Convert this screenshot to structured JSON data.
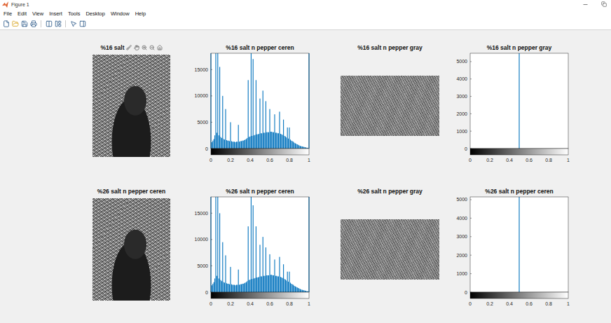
{
  "window": {
    "title": "Figure 1"
  },
  "menu": [
    "File",
    "Edit",
    "View",
    "Insert",
    "Tools",
    "Desktop",
    "Window",
    "Help"
  ],
  "rows": [
    [
      {
        "kind": "photo",
        "title": "%16 salt",
        "toolbar_visible": true
      },
      {
        "kind": "histogram",
        "title": "%16 salt n pepper ceren",
        "toolbar_visible": false,
        "y_max": 18100,
        "y_ticks": [
          "0",
          "5000",
          "10000",
          "15000"
        ],
        "x_ticks": [
          "0",
          "0.2",
          "0.4",
          "0.6",
          "0.8",
          "1"
        ],
        "values": [
          18100,
          1200,
          1500,
          1800,
          2500,
          18100,
          3000,
          18100,
          2500,
          15500,
          2200,
          2000,
          10000,
          1800,
          1700,
          7500,
          1600,
          1500,
          1500,
          1400,
          5000,
          1400,
          1300,
          1300,
          1300,
          1200,
          1300,
          1300,
          4500,
          1300,
          1400,
          1400,
          1500,
          1500,
          1600,
          1700,
          1800,
          2000,
          13000,
          2200,
          2300,
          18100,
          2400,
          17000,
          2500,
          2600,
          13000,
          2700,
          2700,
          2800,
          9500,
          2900,
          2900,
          11000,
          3000,
          3000,
          9000,
          3100,
          3100,
          3100,
          7500,
          3200,
          3200,
          3100,
          3100,
          6500,
          3000,
          3000,
          2900,
          2900,
          7000,
          2800,
          2700,
          2600,
          5500,
          2400,
          2300,
          2100,
          4000,
          1900,
          4000,
          1700,
          1500,
          1400,
          1300,
          1100,
          1000,
          900,
          800,
          700,
          600,
          500,
          450,
          400,
          350,
          300,
          250,
          200,
          150,
          100,
          18100
        ]
      },
      {
        "kind": "noise",
        "title": "%16 salt n pepper gray",
        "toolbar_visible": false
      },
      {
        "kind": "histogram",
        "title": "%16 salt n pepper gray",
        "toolbar_visible": false,
        "y_max": 5480,
        "y_ticks": [
          "0",
          "1000",
          "2000",
          "3000",
          "4000",
          "5000"
        ],
        "x_ticks": [
          "0",
          "0.2",
          "0.4",
          "0.6",
          "0.8",
          "1"
        ],
        "values": [
          0,
          0,
          0,
          0,
          0,
          0,
          0,
          0,
          0,
          0,
          5480,
          0,
          0,
          0,
          0,
          0,
          0,
          0,
          0,
          0,
          0
        ]
      }
    ],
    [
      {
        "kind": "photo",
        "title": "%26 salt n pepper ceren",
        "toolbar_visible": false
      },
      {
        "kind": "histogram",
        "title": "%26 salt n pepper ceren",
        "toolbar_visible": false,
        "y_max": 18100,
        "y_ticks": [
          "0",
          "5000",
          "10000",
          "15000"
        ],
        "x_ticks": [
          "0",
          "0.2",
          "0.4",
          "0.6",
          "0.8",
          "1"
        ],
        "values": [
          18100,
          1300,
          1600,
          1900,
          2600,
          18100,
          3100,
          18100,
          2600,
          15000,
          2300,
          2100,
          9500,
          1900,
          1800,
          7000,
          1700,
          1600,
          1600,
          1500,
          4800,
          1500,
          1400,
          1400,
          1400,
          1300,
          1400,
          1400,
          4300,
          1400,
          1500,
          1500,
          1600,
          1600,
          1700,
          1800,
          1900,
          2100,
          12500,
          2300,
          2400,
          18100,
          2500,
          16500,
          2600,
          2700,
          12500,
          2800,
          2800,
          2900,
          9000,
          3000,
          3000,
          10500,
          3100,
          3100,
          8500,
          3200,
          3200,
          3200,
          7200,
          3300,
          3300,
          3200,
          3200,
          6200,
          3100,
          3100,
          3000,
          3000,
          6700,
          2900,
          2800,
          2700,
          5300,
          2500,
          2400,
          2200,
          3900,
          2000,
          3900,
          1800,
          1600,
          1500,
          1400,
          1200,
          1100,
          1000,
          900,
          800,
          700,
          600,
          500,
          450,
          400,
          350,
          300,
          250,
          200,
          150,
          18100
        ]
      },
      {
        "kind": "noise",
        "title": "%26 salt n pepper gray",
        "toolbar_visible": false
      },
      {
        "kind": "histogram",
        "title": "%26 salt n pepper ceren",
        "toolbar_visible": false,
        "y_max": 5150,
        "y_ticks": [
          "0",
          "1000",
          "2000",
          "3000",
          "4000",
          "5000"
        ],
        "x_ticks": [
          "0",
          "0.2",
          "0.4",
          "0.6",
          "0.8",
          "1"
        ],
        "values": [
          0,
          0,
          0,
          0,
          0,
          0,
          0,
          0,
          0,
          0,
          5150,
          0,
          0,
          0,
          0,
          0,
          0,
          0,
          0,
          0,
          0
        ]
      }
    ]
  ]
}
